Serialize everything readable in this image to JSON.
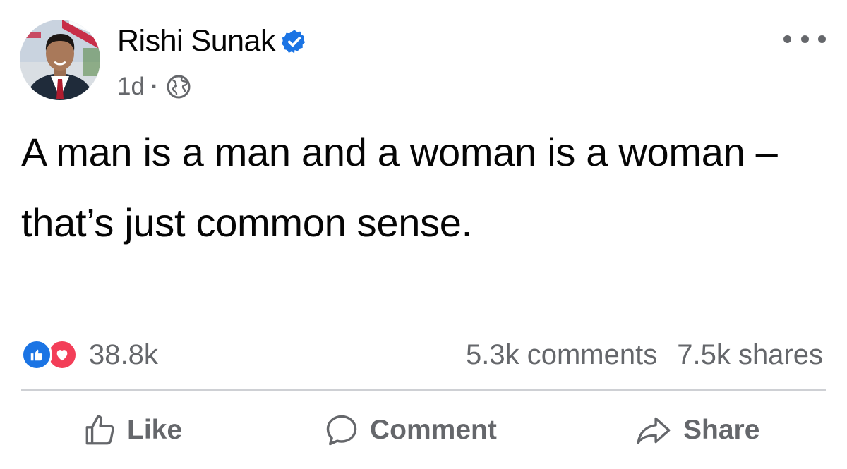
{
  "post": {
    "author": "Rishi Sunak",
    "timestamp": "1d",
    "separator": "·",
    "audience_icon": "globe-icon",
    "verified_icon": "verified-badge-icon",
    "text": "A man is a man and a woman is a woman – that’s just common sense."
  },
  "stats": {
    "reactions": "38.8k",
    "comments": "5.3k comments",
    "shares": "7.5k shares"
  },
  "actions": {
    "like": "Like",
    "comment": "Comment",
    "share": "Share"
  },
  "colors": {
    "primary_text": "#050505",
    "secondary_text": "#65676b",
    "verified_blue": "#1b74e4",
    "like_blue": "#1b74e4",
    "love_red": "#f33e58",
    "divider": "#ced0d4"
  }
}
